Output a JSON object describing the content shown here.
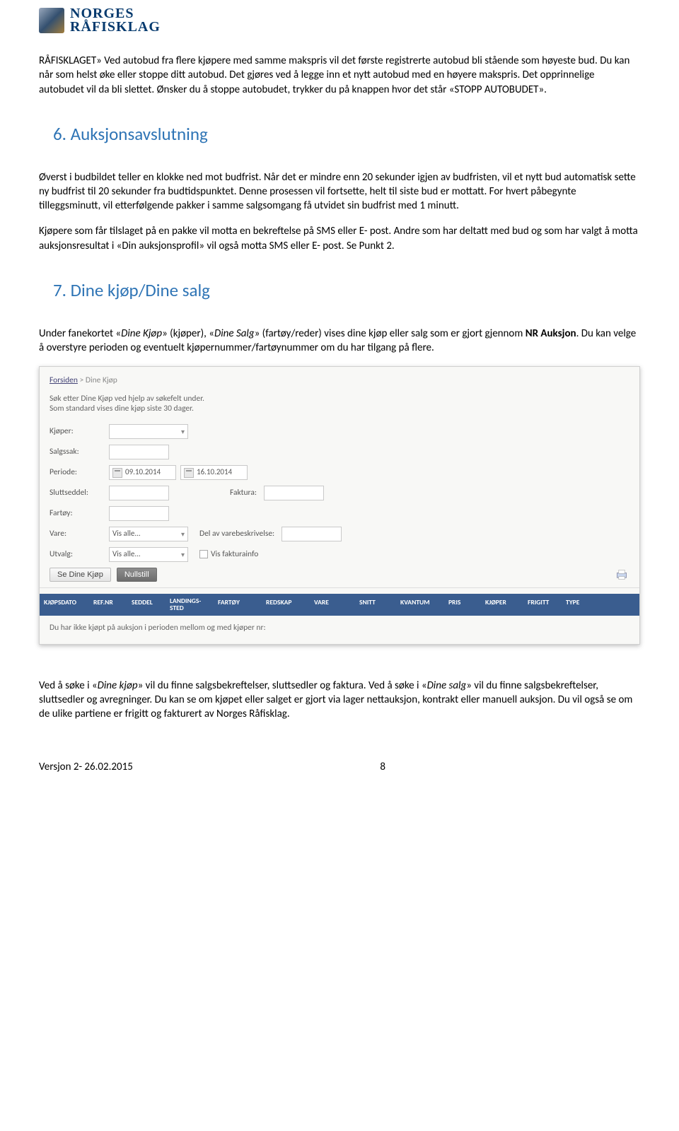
{
  "logo": {
    "line1": "NORGES",
    "line2": "RÅFISKLAG"
  },
  "para1": "RÅFISKLAGET» Ved autobud fra flere kjøpere med samme makspris vil det første registrerte autobud bli stående som høyeste bud. Du kan når som helst øke eller stoppe ditt autobud. Det gjøres ved å legge inn et nytt autobud med en høyere makspris. Det opprinnelige autobudet vil da bli slettet. Ønsker du å stoppe autobudet, trykker du på knappen hvor det står «STOPP AUTOBUDET».",
  "h6": "6. Auksjonsavslutning",
  "para2": "Øverst i budbildet teller en klokke ned mot budfrist. Når det er mindre enn 20 sekunder igjen av budfristen, vil et nytt bud automatisk sette ny budfrist til 20 sekunder fra budtidspunktet. Denne prosessen vil fortsette, helt til siste bud er mottatt. For hvert påbegynte tilleggsminutt, vil etterfølgende pakker i samme salgsomgang få utvidet sin budfrist med 1 minutt.",
  "para3": "Kjøpere som får tilslaget på en pakke vil motta en bekreftelse på SMS eller E- post. Andre som har deltatt med bud og som har valgt å motta auksjonsresultat i «Din auksjonsprofil» vil også motta SMS eller E- post. Se Punkt 2.",
  "h7": "7. Dine kjøp/Dine salg",
  "para4_a": "Under fanekortet «",
  "para4_b": "» (kjøper), «",
  "para4_c": "» (fartøy/reder) vises dine kjøp eller salg som er gjort gjennom ",
  "para4_d": ". Du kan velge å overstyre perioden og eventuelt kjøpernummer/fartøynummer om du har tilgang på flere.",
  "it_dinekjop": "Dine Kjøp",
  "it_dinesalg": "Dine Salg",
  "bold_nr": "NR Auksjon",
  "screenshot": {
    "breadcrumb_a": "Forsiden",
    "breadcrumb_b": " > Dine Kjøp",
    "help1": "Søk etter Dine Kjøp ved hjelp av søkefelt under.",
    "help2": "Som standard vises dine kjøp siste 30 dager.",
    "labels": {
      "kjoper": "Kjøper:",
      "salgssak": "Salgssak:",
      "periode": "Periode:",
      "sluttseddel": "Sluttseddel:",
      "faktura": "Faktura:",
      "fartoy": "Fartøy:",
      "vare": "Vare:",
      "delbeskrivelse": "Del av varebeskrivelse:",
      "utvalg": "Utvalg:",
      "visfakturainfo": "Vis fakturainfo"
    },
    "date_from": "09.10.2014",
    "date_to": "16.10.2014",
    "visalle": "Vis alle...",
    "btn_search": "Se Dine Kjøp",
    "btn_reset": "Nullstill",
    "headers": [
      "KJØPSDATO",
      "REF.NR",
      "SEDDEL",
      "LANDINGS-\nSTED",
      "FARTØY",
      "REDSKAP",
      "VARE",
      "SNITT",
      "KVANTUM",
      "PRIS",
      "KJØPER",
      "FRIGITT",
      "TYPE"
    ],
    "empty": "Du har ikke kjøpt på auksjon i perioden mellom og med kjøper nr:"
  },
  "para5_a": "Ved å søke i «",
  "para5_b": "» vil du finne salgsbekreftelser, sluttsedler og faktura. Ved å søke i «",
  "para5_c": "» vil du finne salgsbekreftelser, sluttsedler og avregninger. Du kan se om kjøpet eller salget er gjort via lager nettauksjon, kontrakt eller manuell auksjon. Du vil også se om de ulike partiene er frigitt og fakturert av Norges Råfisklag.",
  "it_dinekjop2": "Dine kjøp",
  "it_dinesalg2": "Dine salg",
  "footer": {
    "version": "Versjon 2- 26.02.2015",
    "page": "8"
  }
}
